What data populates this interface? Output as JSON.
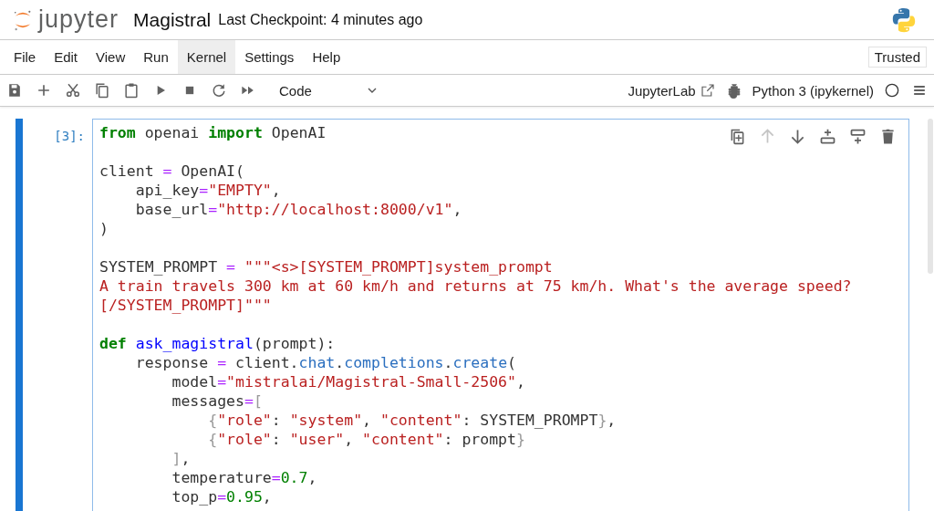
{
  "header": {
    "logo_text": "jupyter",
    "notebook_title": "Magistral",
    "checkpoint": "Last Checkpoint: 4 minutes ago"
  },
  "menu": [
    {
      "label": "File",
      "selected": false
    },
    {
      "label": "Edit",
      "selected": false
    },
    {
      "label": "View",
      "selected": false
    },
    {
      "label": "Run",
      "selected": false
    },
    {
      "label": "Kernel",
      "selected": true
    },
    {
      "label": "Settings",
      "selected": false
    },
    {
      "label": "Help",
      "selected": false
    }
  ],
  "trusted": "Trusted",
  "toolbar": {
    "buttons": [
      {
        "kind": "save"
      },
      {
        "kind": "add"
      },
      {
        "kind": "cut"
      },
      {
        "kind": "copy"
      },
      {
        "kind": "paste"
      },
      {
        "kind": "run"
      },
      {
        "kind": "stop"
      },
      {
        "kind": "restart"
      },
      {
        "kind": "run-all"
      }
    ],
    "cell_type": "Code",
    "open_in": "JupyterLab",
    "kernel": "Python 3 (ipykernel)"
  },
  "cell": {
    "prompt": "[3]:",
    "selected": true,
    "cell_toolbar": [
      {
        "kind": "duplicate",
        "disabled": false
      },
      {
        "kind": "up",
        "disabled": true
      },
      {
        "kind": "down",
        "disabled": false
      },
      {
        "kind": "insert-above",
        "disabled": false
      },
      {
        "kind": "insert-below",
        "disabled": false
      },
      {
        "kind": "delete",
        "disabled": false
      }
    ],
    "lines": [
      {
        "kind": "code",
        "tokens": [
          {
            "kind": "keyword",
            "text": "from"
          },
          {
            "kind": "plain",
            "text": " openai "
          },
          {
            "kind": "keyword",
            "text": "import"
          },
          {
            "kind": "plain",
            "text": " OpenAI"
          }
        ]
      },
      {
        "kind": "blank"
      },
      {
        "kind": "code",
        "tokens": [
          {
            "kind": "plain",
            "text": "client "
          },
          {
            "kind": "operator",
            "text": "="
          },
          {
            "kind": "plain",
            "text": " OpenAI("
          }
        ]
      },
      {
        "kind": "code",
        "tokens": [
          {
            "kind": "plain",
            "text": "    api_key"
          },
          {
            "kind": "operator",
            "text": "="
          },
          {
            "kind": "string",
            "text": "\"EMPTY\""
          },
          {
            "kind": "plain",
            "text": ","
          }
        ]
      },
      {
        "kind": "code",
        "tokens": [
          {
            "kind": "plain",
            "text": "    base_url"
          },
          {
            "kind": "operator",
            "text": "="
          },
          {
            "kind": "string",
            "text": "\"http://localhost:8000/v1\""
          },
          {
            "kind": "plain",
            "text": ","
          }
        ]
      },
      {
        "kind": "code",
        "tokens": [
          {
            "kind": "plain",
            "text": ")"
          }
        ]
      },
      {
        "kind": "blank"
      },
      {
        "kind": "code",
        "tokens": [
          {
            "kind": "plain",
            "text": "SYSTEM_PROMPT "
          },
          {
            "kind": "operator",
            "text": "="
          },
          {
            "kind": "string",
            "text": " \"\"\"<s>[SYSTEM_PROMPT]system_prompt"
          }
        ]
      },
      {
        "kind": "code",
        "tokens": [
          {
            "kind": "string",
            "text": "A train travels 300 km at 60 km/h and returns at 75 km/h. What's the average speed?"
          }
        ]
      },
      {
        "kind": "code",
        "tokens": [
          {
            "kind": "string",
            "text": "[/SYSTEM_PROMPT]\"\"\""
          }
        ]
      },
      {
        "kind": "blank"
      },
      {
        "kind": "code",
        "tokens": [
          {
            "kind": "keyword",
            "text": "def"
          },
          {
            "kind": "function",
            "text": " ask_magistral"
          },
          {
            "kind": "plain",
            "text": "(prompt):"
          }
        ]
      },
      {
        "kind": "code",
        "tokens": [
          {
            "kind": "plain",
            "text": "    response "
          },
          {
            "kind": "operator",
            "text": "="
          },
          {
            "kind": "plain",
            "text": " client."
          },
          {
            "kind": "attribute",
            "text": "chat"
          },
          {
            "kind": "plain",
            "text": "."
          },
          {
            "kind": "attribute",
            "text": "completions"
          },
          {
            "kind": "plain",
            "text": "."
          },
          {
            "kind": "attribute",
            "text": "create"
          },
          {
            "kind": "plain",
            "text": "("
          }
        ]
      },
      {
        "kind": "code",
        "tokens": [
          {
            "kind": "plain",
            "text": "        model"
          },
          {
            "kind": "operator",
            "text": "="
          },
          {
            "kind": "string",
            "text": "\"mistralai/Magistral-Small-2506\""
          },
          {
            "kind": "plain",
            "text": ","
          }
        ]
      },
      {
        "kind": "code",
        "tokens": [
          {
            "kind": "plain",
            "text": "        messages"
          },
          {
            "kind": "operator",
            "text": "="
          },
          {
            "kind": "bracket",
            "text": "["
          }
        ]
      },
      {
        "kind": "code",
        "tokens": [
          {
            "kind": "bracket",
            "text": "            {"
          },
          {
            "kind": "string",
            "text": "\"role\""
          },
          {
            "kind": "plain",
            "text": ": "
          },
          {
            "kind": "string",
            "text": "\"system\""
          },
          {
            "kind": "plain",
            "text": ", "
          },
          {
            "kind": "string",
            "text": "\"content\""
          },
          {
            "kind": "plain",
            "text": ": SYSTEM_PROMPT"
          },
          {
            "kind": "bracket",
            "text": "}"
          },
          {
            "kind": "plain",
            "text": ","
          }
        ]
      },
      {
        "kind": "code",
        "tokens": [
          {
            "kind": "bracket",
            "text": "            {"
          },
          {
            "kind": "string",
            "text": "\"role\""
          },
          {
            "kind": "plain",
            "text": ": "
          },
          {
            "kind": "string",
            "text": "\"user\""
          },
          {
            "kind": "plain",
            "text": ", "
          },
          {
            "kind": "string",
            "text": "\"content\""
          },
          {
            "kind": "plain",
            "text": ": prompt"
          },
          {
            "kind": "bracket",
            "text": "}"
          }
        ]
      },
      {
        "kind": "code",
        "tokens": [
          {
            "kind": "bracket",
            "text": "        ]"
          },
          {
            "kind": "plain",
            "text": ","
          }
        ]
      },
      {
        "kind": "code",
        "tokens": [
          {
            "kind": "plain",
            "text": "        temperature"
          },
          {
            "kind": "operator",
            "text": "="
          },
          {
            "kind": "number",
            "text": "0.7"
          },
          {
            "kind": "plain",
            "text": ","
          }
        ]
      },
      {
        "kind": "code",
        "tokens": [
          {
            "kind": "plain",
            "text": "        top_p"
          },
          {
            "kind": "operator",
            "text": "="
          },
          {
            "kind": "number",
            "text": "0.95"
          },
          {
            "kind": "plain",
            "text": ","
          }
        ]
      }
    ]
  }
}
